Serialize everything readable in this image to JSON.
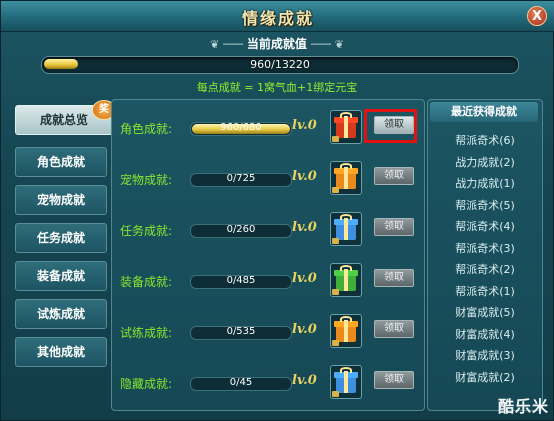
{
  "window": {
    "title": "情缘成就",
    "close_label": "X"
  },
  "summary": {
    "header": "当前成就值",
    "current": 960,
    "max": 13220,
    "progress_text": "960/13220",
    "bonus_text": "每点成就 = 1窝气血+1绑定元宝"
  },
  "sidebar": {
    "badge": "奖",
    "items": [
      {
        "label": "成就总览",
        "active": true
      },
      {
        "label": "角色成就",
        "active": false
      },
      {
        "label": "宠物成就",
        "active": false
      },
      {
        "label": "任务成就",
        "active": false
      },
      {
        "label": "装备成就",
        "active": false
      },
      {
        "label": "试炼成就",
        "active": false
      },
      {
        "label": "其他成就",
        "active": false
      }
    ]
  },
  "categories": [
    {
      "label": "角色成就:",
      "progress_text": "960/680",
      "progress": 1.0,
      "level": "lv.0",
      "claim_label": "领取",
      "gift_color": "red",
      "highlighted": true
    },
    {
      "label": "宠物成就:",
      "progress_text": "0/725",
      "progress": 0,
      "level": "lv.0",
      "claim_label": "领取",
      "gift_color": "orange",
      "highlighted": false
    },
    {
      "label": "任务成就:",
      "progress_text": "0/260",
      "progress": 0,
      "level": "lv.0",
      "claim_label": "领取",
      "gift_color": "blue",
      "highlighted": false
    },
    {
      "label": "装备成就:",
      "progress_text": "0/485",
      "progress": 0,
      "level": "lv.0",
      "claim_label": "领取",
      "gift_color": "green",
      "highlighted": false
    },
    {
      "label": "试练成就:",
      "progress_text": "0/535",
      "progress": 0,
      "level": "lv.0",
      "claim_label": "领取",
      "gift_color": "orange",
      "highlighted": false
    },
    {
      "label": "隐藏成就:",
      "progress_text": "0/45",
      "progress": 0,
      "level": "lv.0",
      "claim_label": "领取",
      "gift_color": "blue",
      "highlighted": false
    }
  ],
  "recent": {
    "header": "最近获得成就",
    "items": [
      "帮派奇术(6)",
      "战力成就(2)",
      "战力成就(1)",
      "帮派奇术(5)",
      "帮派奇术(4)",
      "帮派奇术(3)",
      "帮派奇术(2)",
      "帮派奇术(1)",
      "财富成就(5)",
      "财富成就(4)",
      "财富成就(3)",
      "财富成就(2)"
    ]
  },
  "watermark": "酷乐米",
  "colors": {
    "gift_red": "#d33a1e",
    "gift_orange": "#e98a1c",
    "gift_blue": "#3f8fe0",
    "gift_green": "#3fae3a",
    "highlight": "#e01313"
  }
}
